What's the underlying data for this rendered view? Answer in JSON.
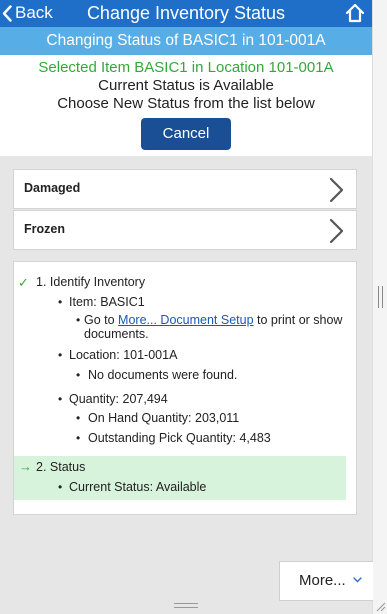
{
  "header": {
    "back_label": "Back",
    "title": "Change Inventory Status",
    "subtitle": "Changing Status of BASIC1 in 101-001A",
    "accent": "#1f6fc9"
  },
  "info": {
    "selected": "Selected Item BASIC1 in Location 101-001A",
    "current": "Current Status is Available",
    "prompt": "Choose New Status from the list below",
    "cancel_label": "Cancel"
  },
  "options": [
    {
      "label": "Damaged"
    },
    {
      "label": "Frozen"
    }
  ],
  "steps": {
    "step1": "1. Identify Inventory",
    "item": "Item: BASIC1",
    "goto_pre": "Go to ",
    "goto_link": "More... Document Setup",
    "goto_post": " to print or show documents.",
    "location": "Location: 101-001A",
    "no_docs": "No documents were found.",
    "quantity": "Quantity: 207,494",
    "on_hand": "On Hand Quantity: 203,011",
    "outstanding": "Outstanding Pick Quantity: 4,483",
    "step2": "2. Status",
    "current_status": "Current Status: Available"
  },
  "footer": {
    "more_label": "More..."
  }
}
